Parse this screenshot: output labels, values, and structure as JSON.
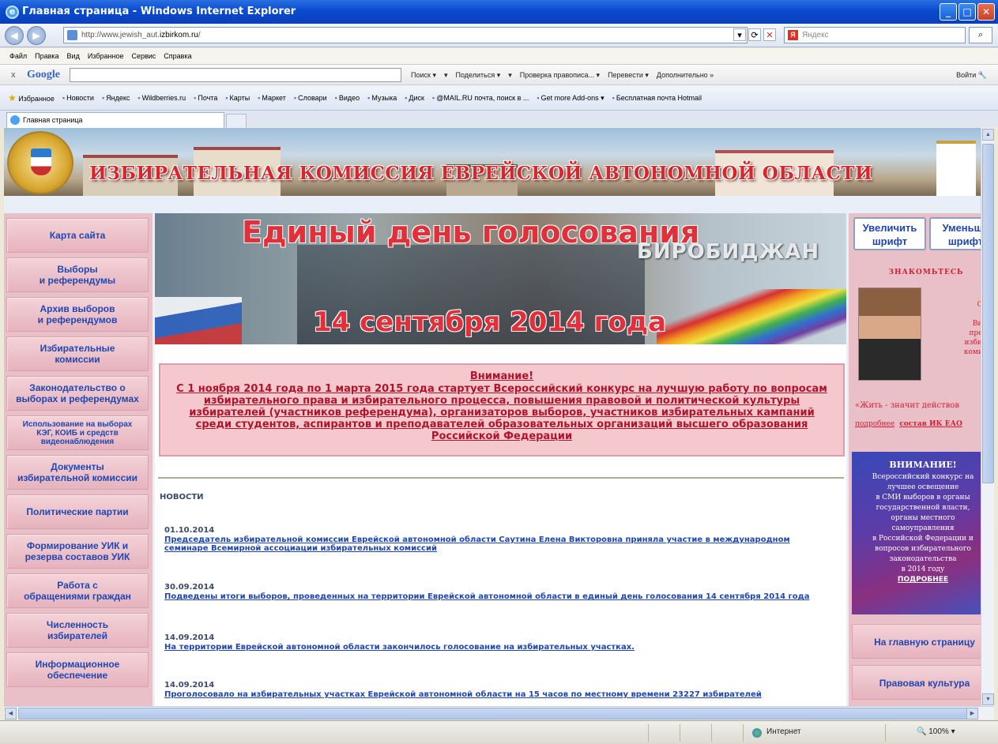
{
  "window": {
    "title": "Главная страница - Windows Internet Explorer"
  },
  "addressbar": {
    "url_prefix": "http://www.jewish_aut.",
    "url_host": "izbirkom.ru",
    "url_suffix": "/",
    "search_placeholder": "Яндекс"
  },
  "menubar": {
    "items": [
      "Файл",
      "Правка",
      "Вид",
      "Избранное",
      "Сервис",
      "Справка"
    ]
  },
  "google_toolbar": {
    "close": "x",
    "logo": "Google",
    "items": [
      "Поиск ▾",
      "▾",
      "Поделиться ▾",
      "▾",
      "Проверка правописа... ▾",
      "Перевести ▾",
      "Дополнительно »"
    ],
    "login": "Войти"
  },
  "favorites": {
    "label": "Избранное",
    "items": [
      "Новости",
      "Яндекс",
      "Wildberries.ru",
      "Почта",
      "Карты",
      "Маркет",
      "Словари",
      "Видео",
      "Музыка",
      "Диск",
      "@MAIL.RU почта, поиск в ...",
      "Get more Add-ons ▾",
      "Бесплатная почта Hotmail"
    ]
  },
  "tabs": [
    {
      "label": "Главная страница"
    }
  ],
  "banner": {
    "title": "ИЗБИРАТЕЛЬНАЯ КОМИССИЯ ЕВРЕЙСКОЙ АВТОНОМНОЙ ОБЛАСТИ"
  },
  "left_nav": [
    {
      "label": "Карта сайта",
      "small": false
    },
    {
      "label": "Выборы\nи референдумы",
      "small": false
    },
    {
      "label": "Архив выборов\nи референдумов",
      "small": false
    },
    {
      "label": "Избирательные\nкомиссии",
      "small": false
    },
    {
      "label": "Законодательство о\nвыборах и референдумах",
      "small": false
    },
    {
      "label": "Использование на выборах\nКЭГ, КОИБ и средств\nвидеонаблюдения",
      "small": true
    },
    {
      "label": "Документы\nизбирательной комиссии",
      "small": false
    },
    {
      "label": "Политические партии",
      "small": false
    },
    {
      "label": "Формирование УИК и\nрезерва составов УИК",
      "small": false
    },
    {
      "label": "Работа с\nобращениями граждан",
      "small": false
    },
    {
      "label": "Численность\nизбирателей",
      "small": false
    },
    {
      "label": "Информационное\nобеспечение",
      "small": false
    }
  ],
  "election_banner": {
    "title": "Единый день голосования",
    "date": "14 сентября 2014 года",
    "city": "БИРОБИДЖАН"
  },
  "notice": {
    "title": "Внимание!",
    "text": "С 1 ноября 2014 года по 1 марта 2015 года стартует Всероссийский конкурс на лучшую работу по вопросам избирательного права и избирательного процесса, повышения правовой и политической культуры избирателей (участников референдума), организаторов выборов, участников избирательных кампаний среди студентов, аспирантов и преподавателей образовательных организаций высшего образования Российской Федерации"
  },
  "news": {
    "heading": "НОВОСТИ",
    "items": [
      {
        "date": "01.10.2014",
        "title": "Председатель избирательной комиссии Еврейской автономной области Саутина Елена Викторовна приняла участие в международном семинаре Всемирной ассоциации избирательных комиссий"
      },
      {
        "date": "30.09.2014",
        "title": "Подведены итоги выборов, проведенных на территории Еврейской автономной области в единый день голосования 14 сентября 2014 года"
      },
      {
        "date": "14.09.2014",
        "title": "На территории Еврейской автономной области закончилось голосование на избирательных участках."
      },
      {
        "date": "14.09.2014",
        "title": "Проголосовало на избирательных участках Еврейской автономной области на 15 часов по местному времени 23227 избирателей"
      }
    ]
  },
  "right": {
    "increase_font": "Увеличить\nшрифт",
    "decrease_font": "Уменьши\nшрифт",
    "meet_title": "ЗНАКОМЬТЕСЬ",
    "photo_caption": "Сау\nЕл\nВикт\nпредс\nизбира\nкомисс",
    "quote": "«Жить - значит действов",
    "more_link": "подробнее",
    "composition_link": "состав ИК ЕАО",
    "attention": {
      "title": "ВНИМАНИЕ!",
      "text": "Всероссийский конкурс на\nлучшее освещение\nв СМИ выборов в органы\nгосударственной власти,\nорганы местного\nсамоуправления\nв Российской Федерации и\nвопросов избирательного\nзаконодательства\nв 2014 году",
      "more": "ПОДРОБНЕЕ"
    },
    "nav": [
      {
        "label": "На главную страницу"
      },
      {
        "label": "Правовая культура"
      }
    ]
  },
  "statusbar": {
    "zone": "Интернет",
    "zoom": "100%"
  }
}
